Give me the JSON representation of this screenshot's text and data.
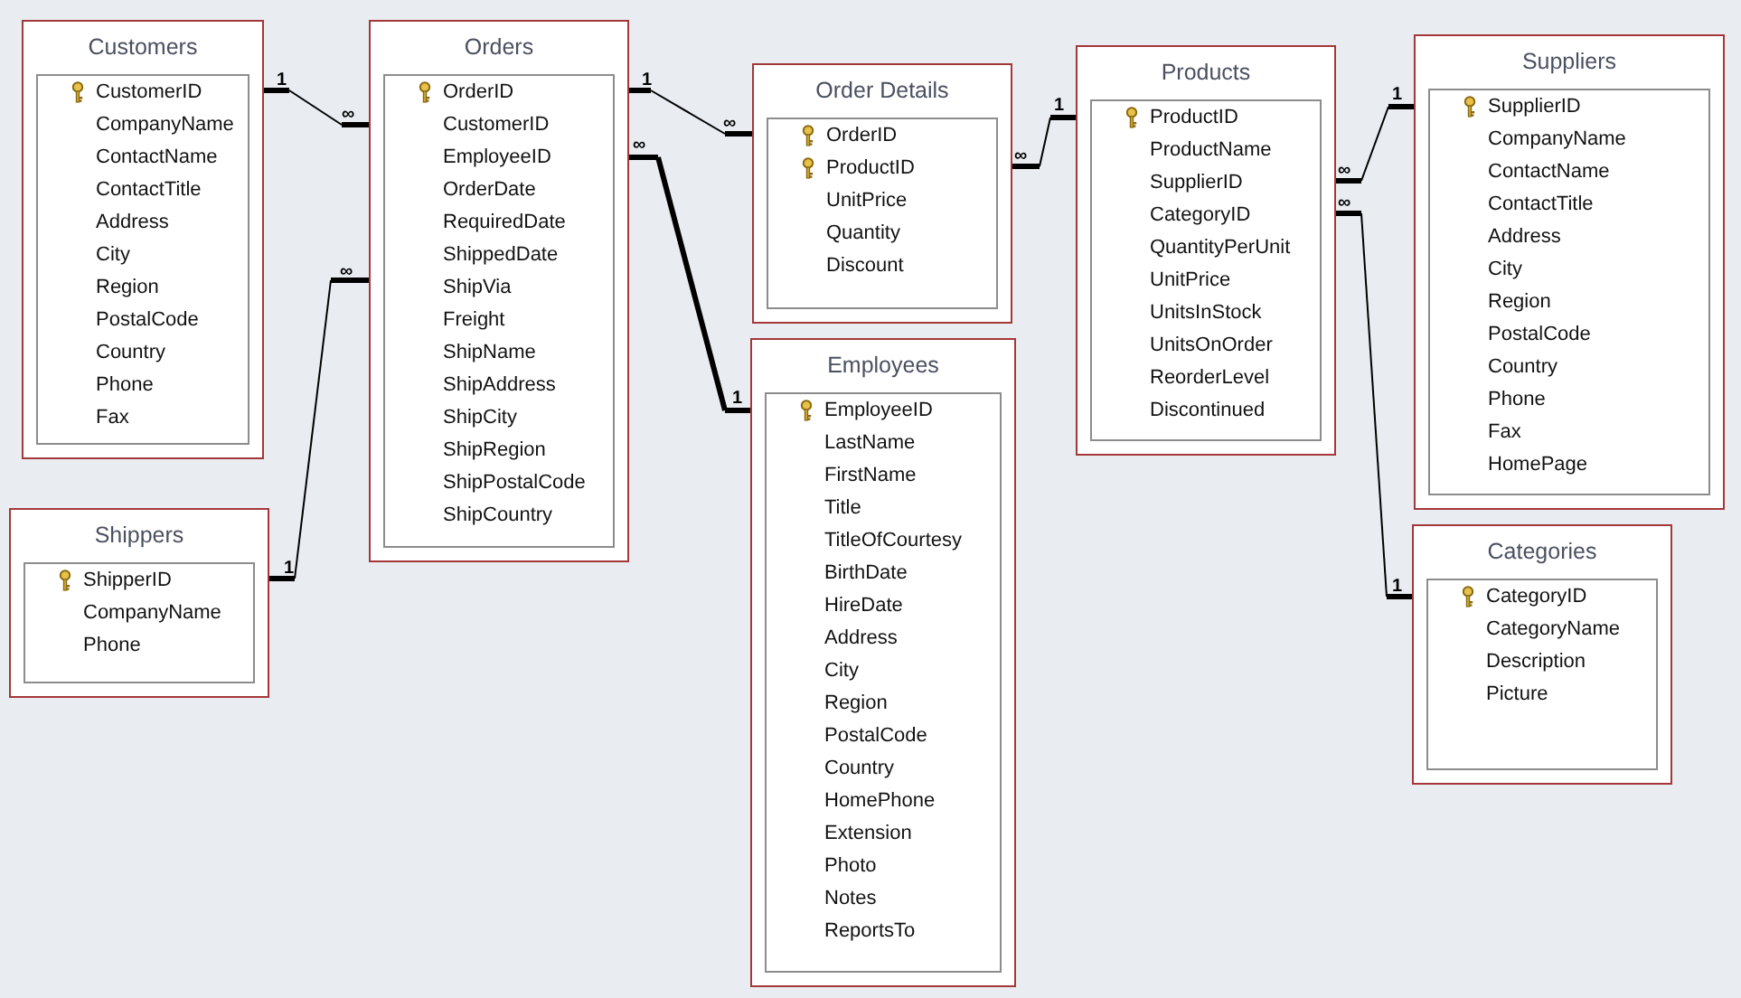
{
  "tables": [
    {
      "name": "Customers",
      "fields": [
        {
          "name": "CustomerID",
          "primary_key": true
        },
        {
          "name": "CompanyName",
          "primary_key": false
        },
        {
          "name": "ContactName",
          "primary_key": false
        },
        {
          "name": "ContactTitle",
          "primary_key": false
        },
        {
          "name": "Address",
          "primary_key": false
        },
        {
          "name": "City",
          "primary_key": false
        },
        {
          "name": "Region",
          "primary_key": false
        },
        {
          "name": "PostalCode",
          "primary_key": false
        },
        {
          "name": "Country",
          "primary_key": false
        },
        {
          "name": "Phone",
          "primary_key": false
        },
        {
          "name": "Fax",
          "primary_key": false
        }
      ]
    },
    {
      "name": "Orders",
      "fields": [
        {
          "name": "OrderID",
          "primary_key": true
        },
        {
          "name": "CustomerID",
          "primary_key": false
        },
        {
          "name": "EmployeeID",
          "primary_key": false
        },
        {
          "name": "OrderDate",
          "primary_key": false
        },
        {
          "name": "RequiredDate",
          "primary_key": false
        },
        {
          "name": "ShippedDate",
          "primary_key": false
        },
        {
          "name": "ShipVia",
          "primary_key": false
        },
        {
          "name": "Freight",
          "primary_key": false
        },
        {
          "name": "ShipName",
          "primary_key": false
        },
        {
          "name": "ShipAddress",
          "primary_key": false
        },
        {
          "name": "ShipCity",
          "primary_key": false
        },
        {
          "name": "ShipRegion",
          "primary_key": false
        },
        {
          "name": "ShipPostalCode",
          "primary_key": false
        },
        {
          "name": "ShipCountry",
          "primary_key": false
        }
      ]
    },
    {
      "name": "Order Details",
      "fields": [
        {
          "name": "OrderID",
          "primary_key": true
        },
        {
          "name": "ProductID",
          "primary_key": true
        },
        {
          "name": "UnitPrice",
          "primary_key": false
        },
        {
          "name": "Quantity",
          "primary_key": false
        },
        {
          "name": "Discount",
          "primary_key": false
        }
      ]
    },
    {
      "name": "Products",
      "fields": [
        {
          "name": "ProductID",
          "primary_key": true
        },
        {
          "name": "ProductName",
          "primary_key": false
        },
        {
          "name": "SupplierID",
          "primary_key": false
        },
        {
          "name": "CategoryID",
          "primary_key": false
        },
        {
          "name": "QuantityPerUnit",
          "primary_key": false
        },
        {
          "name": "UnitPrice",
          "primary_key": false
        },
        {
          "name": "UnitsInStock",
          "primary_key": false
        },
        {
          "name": "UnitsOnOrder",
          "primary_key": false
        },
        {
          "name": "ReorderLevel",
          "primary_key": false
        },
        {
          "name": "Discontinued",
          "primary_key": false
        }
      ]
    },
    {
      "name": "Suppliers",
      "fields": [
        {
          "name": "SupplierID",
          "primary_key": true
        },
        {
          "name": "CompanyName",
          "primary_key": false
        },
        {
          "name": "ContactName",
          "primary_key": false
        },
        {
          "name": "ContactTitle",
          "primary_key": false
        },
        {
          "name": "Address",
          "primary_key": false
        },
        {
          "name": "City",
          "primary_key": false
        },
        {
          "name": "Region",
          "primary_key": false
        },
        {
          "name": "PostalCode",
          "primary_key": false
        },
        {
          "name": "Country",
          "primary_key": false
        },
        {
          "name": "Phone",
          "primary_key": false
        },
        {
          "name": "Fax",
          "primary_key": false
        },
        {
          "name": "HomePage",
          "primary_key": false
        }
      ]
    },
    {
      "name": "Shippers",
      "fields": [
        {
          "name": "ShipperID",
          "primary_key": true
        },
        {
          "name": "CompanyName",
          "primary_key": false
        },
        {
          "name": "Phone",
          "primary_key": false
        }
      ]
    },
    {
      "name": "Employees",
      "fields": [
        {
          "name": "EmployeeID",
          "primary_key": true
        },
        {
          "name": "LastName",
          "primary_key": false
        },
        {
          "name": "FirstName",
          "primary_key": false
        },
        {
          "name": "Title",
          "primary_key": false
        },
        {
          "name": "TitleOfCourtesy",
          "primary_key": false
        },
        {
          "name": "BirthDate",
          "primary_key": false
        },
        {
          "name": "HireDate",
          "primary_key": false
        },
        {
          "name": "Address",
          "primary_key": false
        },
        {
          "name": "City",
          "primary_key": false
        },
        {
          "name": "Region",
          "primary_key": false
        },
        {
          "name": "PostalCode",
          "primary_key": false
        },
        {
          "name": "Country",
          "primary_key": false
        },
        {
          "name": "HomePhone",
          "primary_key": false
        },
        {
          "name": "Extension",
          "primary_key": false
        },
        {
          "name": "Photo",
          "primary_key": false
        },
        {
          "name": "Notes",
          "primary_key": false
        },
        {
          "name": "ReportsTo",
          "primary_key": false
        }
      ]
    },
    {
      "name": "Categories",
      "fields": [
        {
          "name": "CategoryID",
          "primary_key": true
        },
        {
          "name": "CategoryName",
          "primary_key": false
        },
        {
          "name": "Description",
          "primary_key": false
        },
        {
          "name": "Picture",
          "primary_key": false
        }
      ]
    }
  ],
  "relationships": [
    {
      "one_label": "1",
      "many_label": "∞"
    },
    {
      "one_label": "1",
      "many_label": "∞"
    },
    {
      "one_label": "1",
      "many_label": "∞"
    },
    {
      "one_label": "1",
      "many_label": "∞"
    },
    {
      "one_label": "1",
      "many_label": "∞"
    },
    {
      "one_label": "1",
      "many_label": "∞"
    },
    {
      "one_label": "1",
      "many_label": "∞"
    }
  ]
}
